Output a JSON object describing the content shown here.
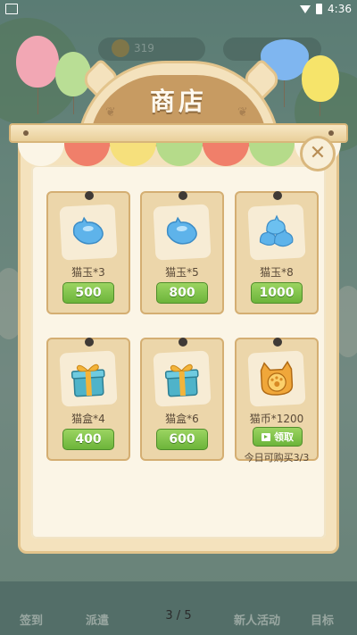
{
  "status_bar": {
    "time": "4:36"
  },
  "background": {
    "coin_value": "319",
    "bottom_tabs": [
      "签到",
      "派遣",
      "新人活动",
      "目标"
    ]
  },
  "shop": {
    "title": "商店",
    "close_icon": "close-x-icon",
    "awning_colors": [
      "#fbf5e6",
      "#f07f6a",
      "#f6e07c",
      "#b5db8a",
      "#f07f6a",
      "#b5db8a",
      "#fbf5e6"
    ],
    "items": [
      {
        "name": "猫玉*3",
        "price": "500",
        "icon": "cat-jade-icon"
      },
      {
        "name": "猫玉*5",
        "price": "800",
        "icon": "cat-jade-icon"
      },
      {
        "name": "猫玉*8",
        "price": "1000",
        "icon": "cat-jade-pile-icon"
      },
      {
        "name": "猫盒*4",
        "price": "400",
        "icon": "gift-box-icon"
      },
      {
        "name": "猫盒*6",
        "price": "600",
        "icon": "gift-box-icon"
      },
      {
        "name": "猫币*1200",
        "claim_label": "领取",
        "limit": "今日可购买3/3",
        "icon": "cat-coin-icon"
      }
    ]
  },
  "page_indicator": "3 / 5",
  "colors": {
    "button_green": "#6cb43a",
    "panel": "#f4e2bd",
    "title_brown": "#c79b62"
  }
}
